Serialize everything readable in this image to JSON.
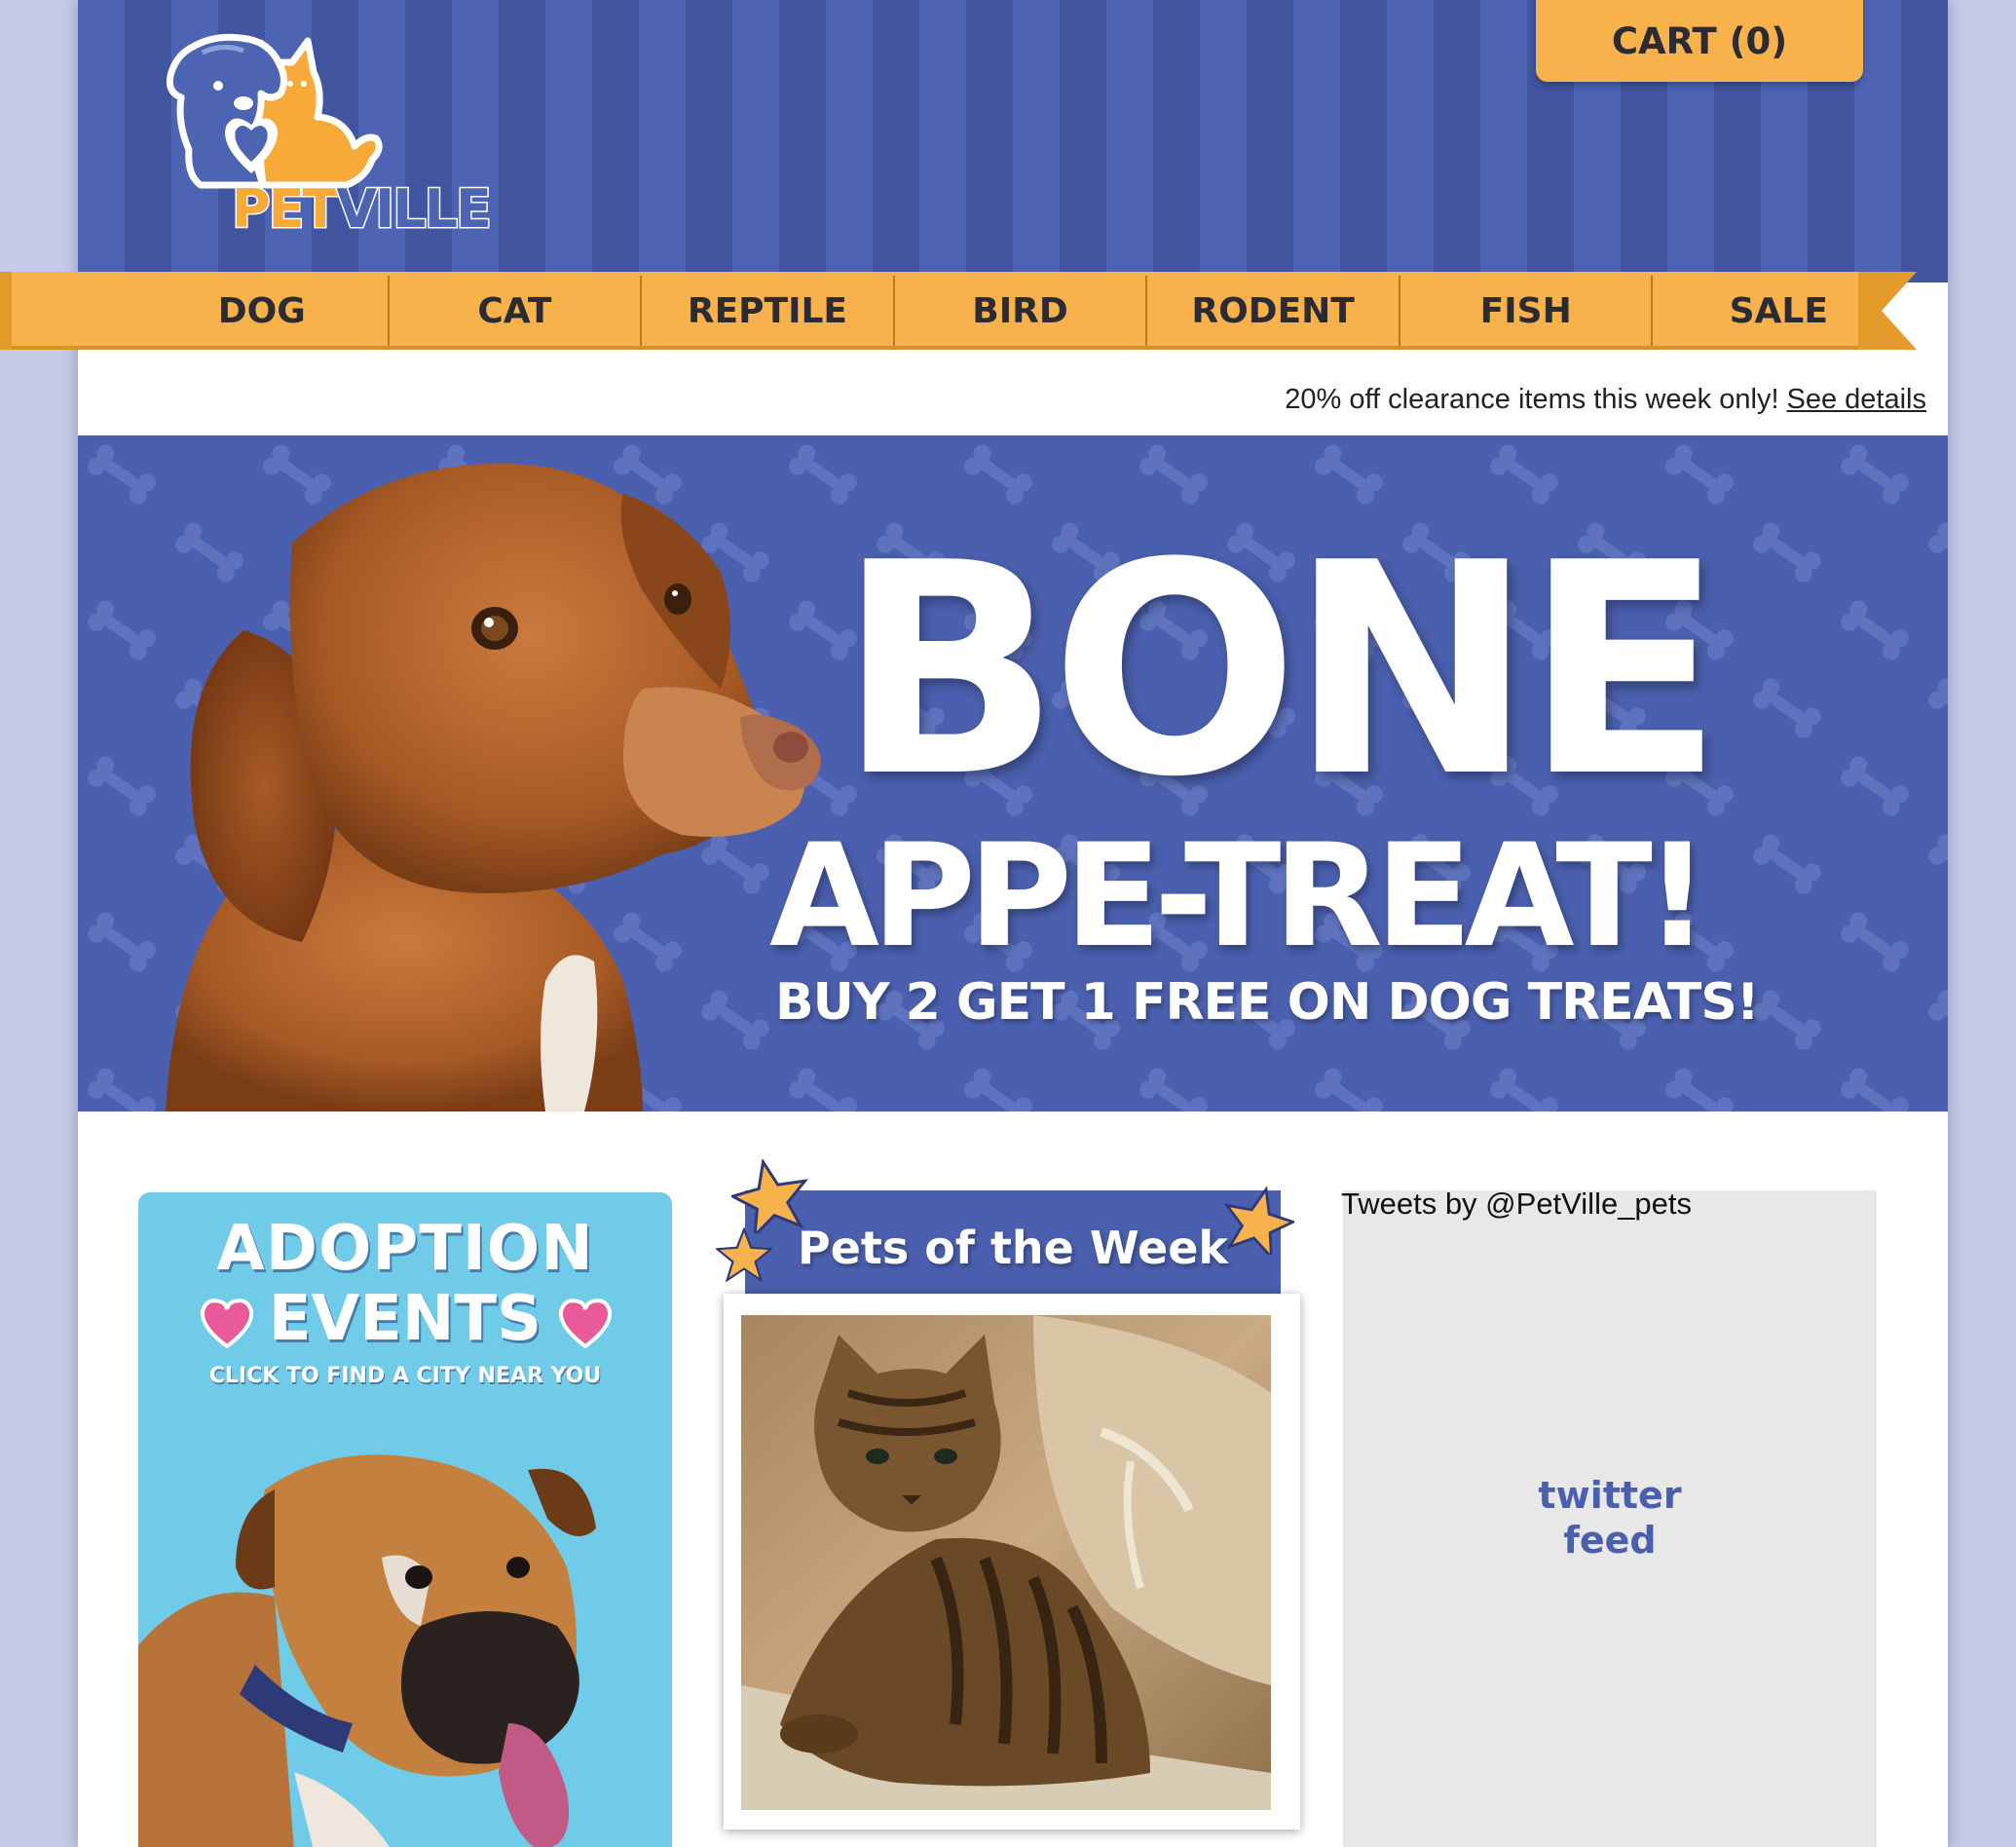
{
  "brand": {
    "name_part1": "PET",
    "name_part2": "VILLE"
  },
  "cart": {
    "label": "CART (0)"
  },
  "nav": {
    "items": [
      "DOG",
      "CAT",
      "REPTILE",
      "BIRD",
      "RODENT",
      "FISH",
      "SALE"
    ]
  },
  "promo": {
    "text": "20% off clearance items this week only!",
    "link_label": "See details"
  },
  "hero": {
    "title_line1": "BONE",
    "title_line2": "APPE-TREAT!",
    "subtitle": "BUY 2 GET 1 FREE ON DOG TREATS!"
  },
  "adoption": {
    "title_line1": "ADOPTION",
    "title_line2": "EVENTS",
    "subtitle": "CLICK TO FIND A CITY NEAR YOU"
  },
  "pets_of_week": {
    "title": "Pets of the Week"
  },
  "twitter": {
    "label": "Tweets by @PetVille_pets",
    "placeholder_line1": "twitter",
    "placeholder_line2": "feed"
  },
  "colors": {
    "brand_blue": "#4a5fad",
    "brand_orange": "#f8b24b",
    "adoption_cyan": "#6fcbe8",
    "page_background": "#c5cae5"
  }
}
